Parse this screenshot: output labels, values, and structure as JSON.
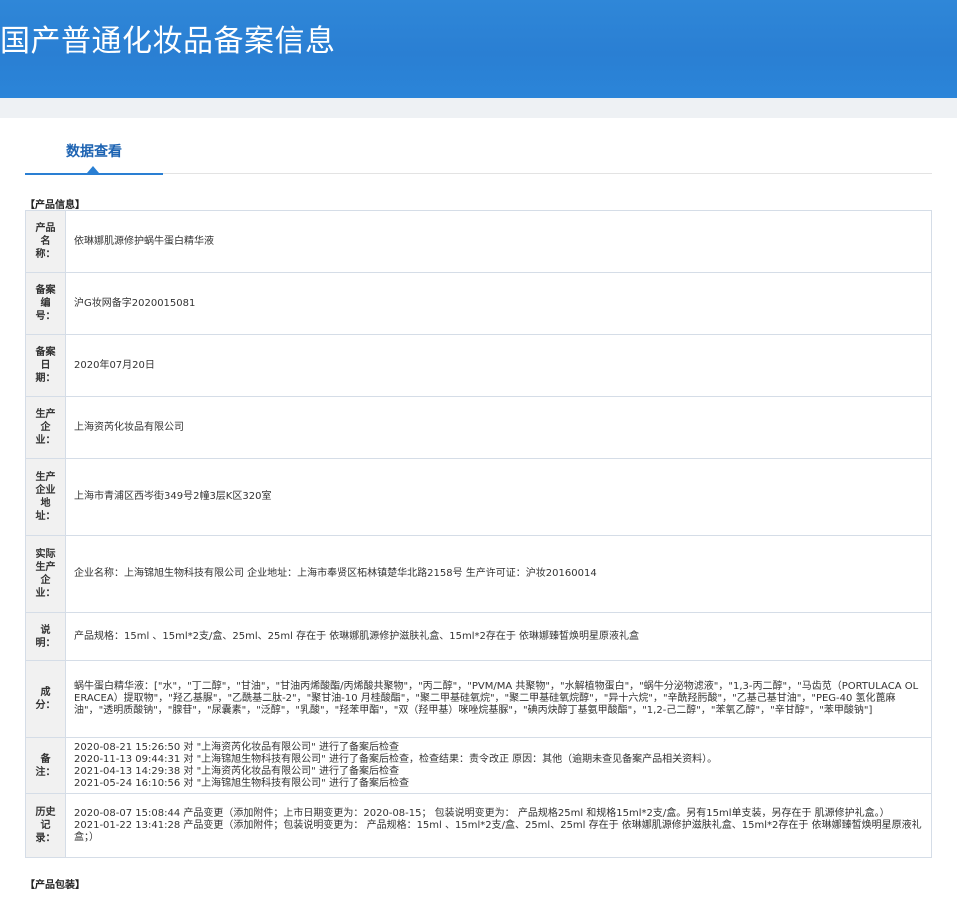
{
  "header": {
    "title": "国产普通化妆品备案信息"
  },
  "tabs": [
    {
      "label": "数据查看"
    }
  ],
  "product_info": {
    "section_title": "【产品信息】",
    "rows": [
      {
        "label": "产品名称：",
        "lines": [
          "依琳娜肌源修护蜗牛蛋白精华液"
        ]
      },
      {
        "label": "备案编号：",
        "lines": [
          "沪G妆网备字2020015081"
        ]
      },
      {
        "label": "备案日期：",
        "lines": [
          "2020年07月20日"
        ]
      },
      {
        "label": "生产企业：",
        "lines": [
          "上海资芮化妆品有限公司"
        ]
      },
      {
        "label": "生产企业地址：",
        "lines": [
          "上海市青浦区西岑街349号2幢3层K区320室"
        ]
      },
      {
        "label": "实际生产企业：",
        "lines": [
          "企业名称：上海锦旭生物科技有限公司 企业地址：上海市奉贤区柘林镇楚华北路2158号 生产许可证：沪妆20160014"
        ]
      },
      {
        "label": "说明：",
        "lines": [
          "产品规格：15ml 、15ml*2支/盒、25ml、25ml 存在于 依琳娜肌源修护滋肤礼盒、15ml*2存在于 依琳娜臻皙焕明星原液礼盒"
        ]
      },
      {
        "label": "成分：",
        "lines": [
          "蜗牛蛋白精华液：[\"水\"，\"丁二醇\"，\"甘油\"，\"甘油丙烯酸酯/丙烯酸共聚物\"，\"丙二醇\"，\"PVM/MA 共聚物\"，\"水解植物蛋白\"，\"蜗牛分泌物滤液\"，\"1,3-丙二醇\"，\"马齿苋（PORTULACA OLERACEA）提取物\"，\"羟乙基脲\"，\"乙酰基二肽-2\"，\"聚甘油-10 月桂酸酯\"，\"聚二甲基硅氧烷\"，\"聚二甲基硅氧烷醇\"，\"异十六烷\"，\"辛酰羟肟酸\"，\"乙基己基甘油\"，\"PEG-40 氢化蓖麻油\"，\"透明质酸钠\"，\"腺苷\"，\"尿囊素\"，\"泛醇\"，\"乳酸\"，\"羟苯甲酯\"，\"双（羟甲基）咪唑烷基脲\"，\"碘丙炔醇丁基氨甲酸酯\"，\"1,2-己二醇\"，\"苯氧乙醇\"，\"辛甘醇\"，\"苯甲酸钠\"]"
        ]
      },
      {
        "label": "备注：",
        "lines": [
          "2020-08-21 15:26:50 对 \"上海资芮化妆品有限公司\" 进行了备案后检查",
          "2020-11-13 09:44:31 对 \"上海锦旭生物科技有限公司\" 进行了备案后检查，检查结果：责令改正 原因：其他（逾期未查见备案产品相关资料）。",
          "2021-04-13 14:29:38 对 \"上海资芮化妆品有限公司\" 进行了备案后检查",
          "2021-05-24 16:10:56 对 \"上海锦旭生物科技有限公司\" 进行了备案后检查"
        ]
      },
      {
        "label": "历史记录：",
        "lines": [
          "2020-08-07 15:08:44 产品变更（添加附件；上市日期变更为：2020-08-15； 包装说明变更为： 产品规格25ml 和规格15ml*2支/盒。另有15ml单支装，另存在于 肌源修护礼盒。）",
          "2021-01-22 13:41:28 产品变更（添加附件；包装说明变更为： 产品规格：15ml 、15ml*2支/盒、25ml、25ml 存在于 依琳娜肌源修护滋肤礼盒、15ml*2存在于 依琳娜臻皙焕明星原液礼盒；）"
        ]
      }
    ]
  },
  "packaging": {
    "section_title": "【产品包装】"
  }
}
